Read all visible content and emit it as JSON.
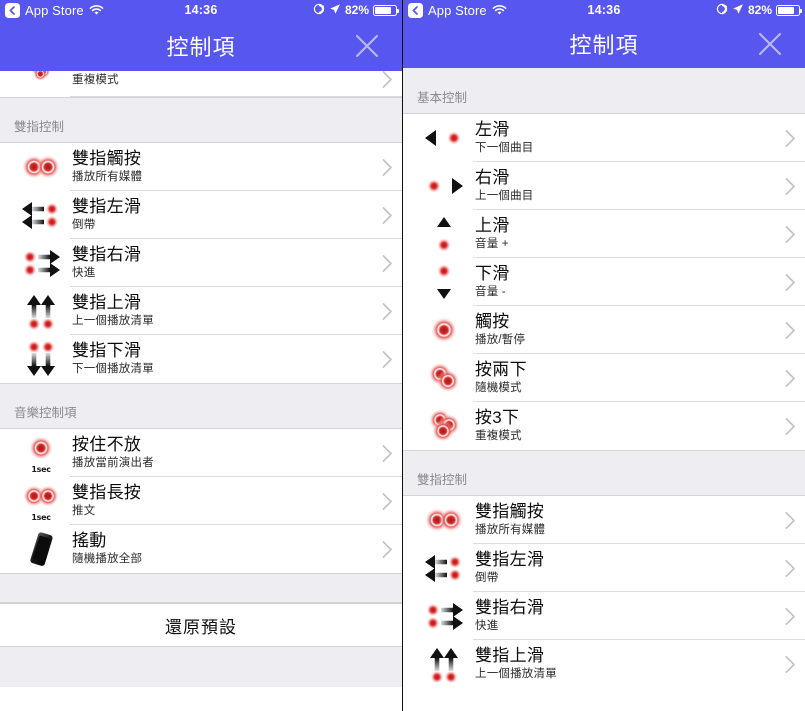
{
  "status_bar": {
    "back_app": "App Store",
    "wifi_icon": "wifi-icon",
    "time": "14:36",
    "alarm_icon": "orientation-lock-icon",
    "location_icon": "location-arrow-icon",
    "battery_pct": "82%",
    "battery_level": 82
  },
  "nav": {
    "title": "控制項",
    "close_icon": "close-icon"
  },
  "colors": {
    "nav_blue": "#5757f0",
    "section_gray": "#eeeef2",
    "divider": "#dcdcdf",
    "accent_red": "#d62a2a",
    "chevron": "#c4c4c8"
  },
  "left_screen": {
    "partial_row": {
      "subtitle": "重複模式",
      "icon": "triple-tap-icon"
    },
    "sections": [
      {
        "header": "雙指控制",
        "rows": [
          {
            "title": "雙指觸按",
            "subtitle": "播放所有媒體",
            "icon": "two-finger-tap-icon"
          },
          {
            "title": "雙指左滑",
            "subtitle": "倒帶",
            "icon": "two-finger-swipe-left-icon"
          },
          {
            "title": "雙指右滑",
            "subtitle": "快進",
            "icon": "two-finger-swipe-right-icon"
          },
          {
            "title": "雙指上滑",
            "subtitle": "上一個播放清單",
            "icon": "two-finger-swipe-up-icon"
          },
          {
            "title": "雙指下滑",
            "subtitle": "下一個播放清單",
            "icon": "two-finger-swipe-down-icon"
          }
        ]
      },
      {
        "header": "音樂控制項",
        "rows": [
          {
            "title": "按住不放",
            "subtitle": "播放當前演出者",
            "icon": "press-and-hold-icon",
            "badge": "1sec"
          },
          {
            "title": "雙指長按",
            "subtitle": "推文",
            "icon": "two-finger-long-press-icon",
            "badge": "1sec"
          },
          {
            "title": "搖動",
            "subtitle": "隨機播放全部",
            "icon": "shake-device-icon"
          }
        ]
      }
    ],
    "footer_button": "還原預設"
  },
  "right_screen": {
    "sections": [
      {
        "header": "基本控制",
        "rows": [
          {
            "title": "左滑",
            "subtitle": "下一個曲目",
            "icon": "swipe-left-icon"
          },
          {
            "title": "右滑",
            "subtitle": "上一個曲目",
            "icon": "swipe-right-icon"
          },
          {
            "title": "上滑",
            "subtitle": "音量 +",
            "icon": "swipe-up-icon"
          },
          {
            "title": "下滑",
            "subtitle": "音量 -",
            "icon": "swipe-down-icon"
          },
          {
            "title": "觸按",
            "subtitle": "播放/暫停",
            "icon": "single-tap-icon"
          },
          {
            "title": "按兩下",
            "subtitle": "隨機模式",
            "icon": "double-tap-icon"
          },
          {
            "title": "按3下",
            "subtitle": "重複模式",
            "icon": "triple-tap-icon"
          }
        ]
      },
      {
        "header": "雙指控制",
        "rows": [
          {
            "title": "雙指觸按",
            "subtitle": "播放所有媒體",
            "icon": "two-finger-tap-icon"
          },
          {
            "title": "雙指左滑",
            "subtitle": "倒帶",
            "icon": "two-finger-swipe-left-icon"
          },
          {
            "title": "雙指右滑",
            "subtitle": "快進",
            "icon": "two-finger-swipe-right-icon"
          },
          {
            "title": "雙指上滑",
            "subtitle": "上一個播放清單",
            "icon": "two-finger-swipe-up-icon"
          }
        ]
      }
    ]
  }
}
